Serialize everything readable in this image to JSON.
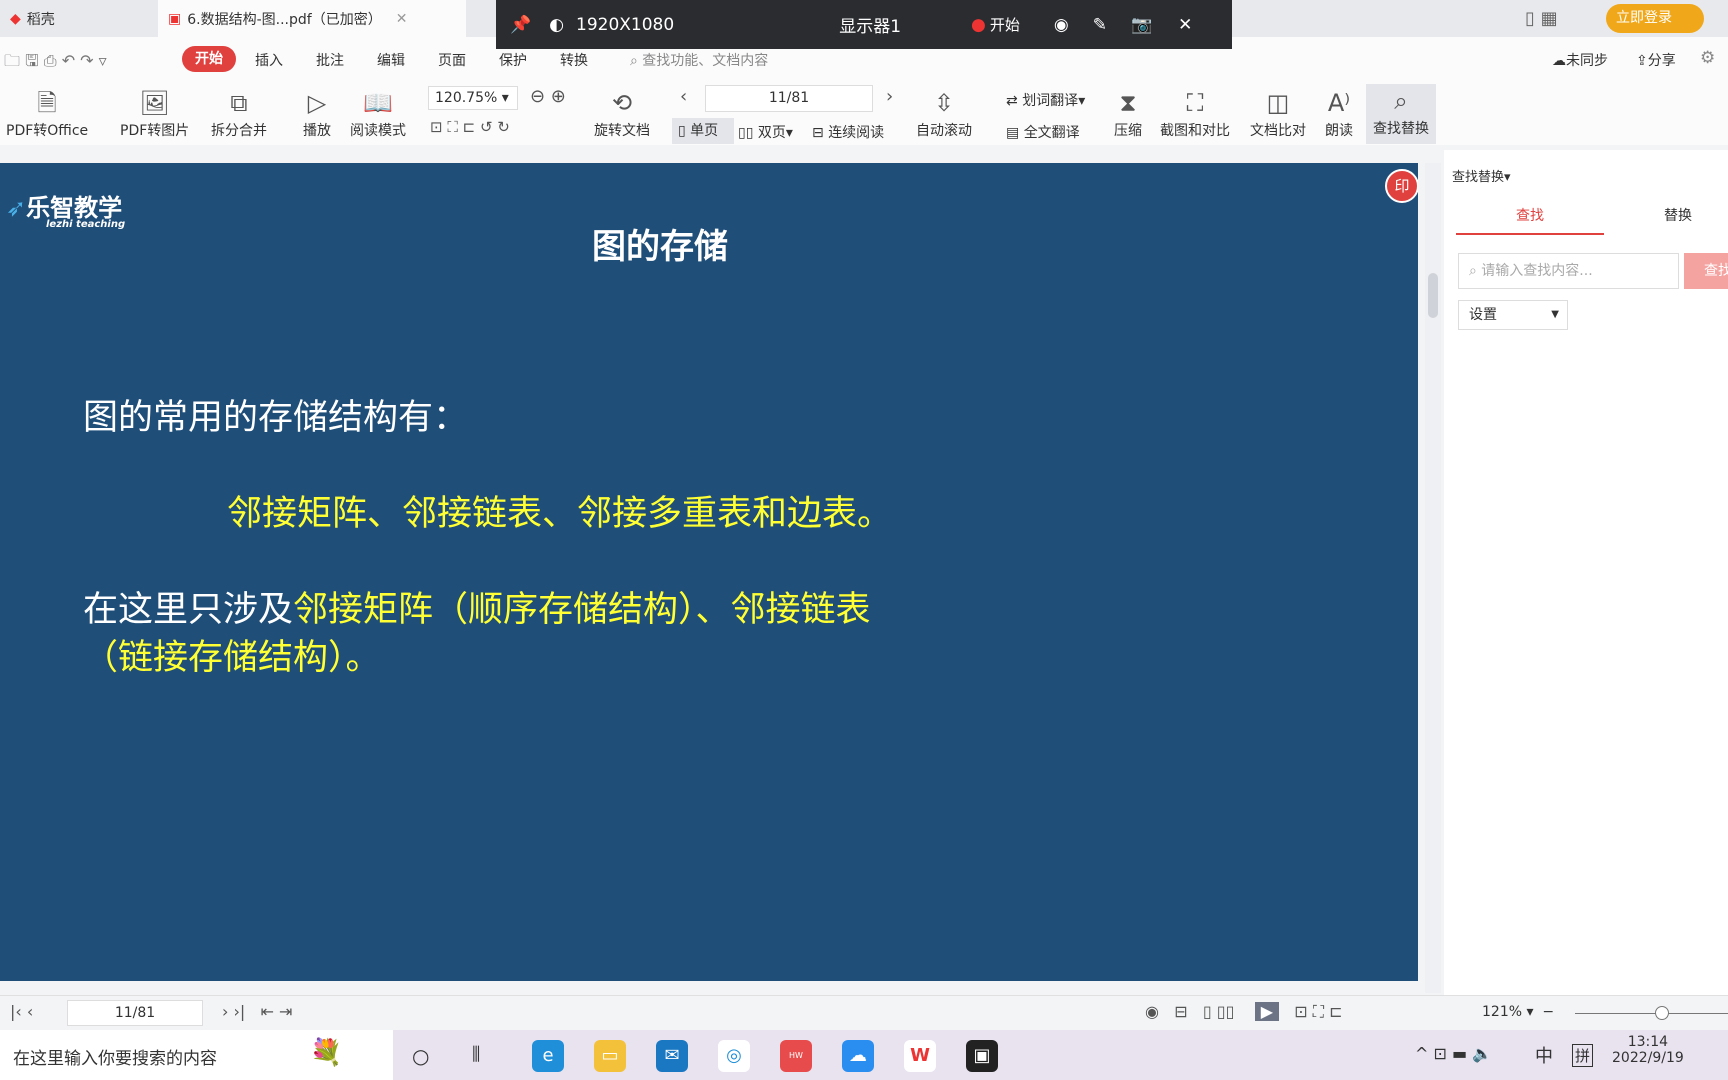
{
  "tabs": [
    {
      "label": "稻壳"
    },
    {
      "label": "6.数据结构-图...pdf（已加密）"
    }
  ],
  "login_label": "立即登录",
  "recorder": {
    "resolution": "1920X1080",
    "display": "显示器1",
    "start": "开始"
  },
  "menu": {
    "items": [
      "开始",
      "插入",
      "批注",
      "编辑",
      "页面",
      "保护",
      "转换"
    ],
    "search_placeholder": "查找功能、文档内容",
    "sync": "未同步",
    "share": "分享"
  },
  "toolbar": {
    "pdf_to_office": "PDF转Office",
    "pdf_to_image": "PDF转图片",
    "split_merge": "拆分合并",
    "play": "播放",
    "read_mode": "阅读模式",
    "zoom": "120.75%",
    "rotate": "旋转文档",
    "page": "11/81",
    "single": "单页",
    "double": "双页",
    "continuous": "连续阅读",
    "auto_scroll": "自动滚动",
    "word_translate": "划词翻译",
    "full_translate": "全文翻译",
    "compress": "压缩",
    "screenshot_compare": "截图和对比",
    "doc_compare": "文档比对",
    "read_aloud": "朗读",
    "find_replace": "查找替换"
  },
  "slide": {
    "logo": "乐智教学",
    "logo_sub": "lezhi teaching",
    "title": "图的存储",
    "line1": "图的常用的存储结构有：",
    "line2": "邻接矩阵、邻接链表、邻接多重表和边表。",
    "line3_white": "在这里只涉及",
    "line3_yellow": "邻接矩阵（顺序存储结构）、邻接链表",
    "line4": "（链接存储结构）。"
  },
  "panel": {
    "title": "查找替换",
    "tab_find": "查找",
    "tab_replace": "替换",
    "placeholder": "请输入查找内容...",
    "find_btn": "查找",
    "settings": "设置"
  },
  "status": {
    "page": "11/81",
    "zoom": "121%"
  },
  "taskbar": {
    "search": "在这里输入你要搜索的内容",
    "ime": "中",
    "ime2": "拼",
    "time": "13:14",
    "date": "2022/9/19"
  }
}
